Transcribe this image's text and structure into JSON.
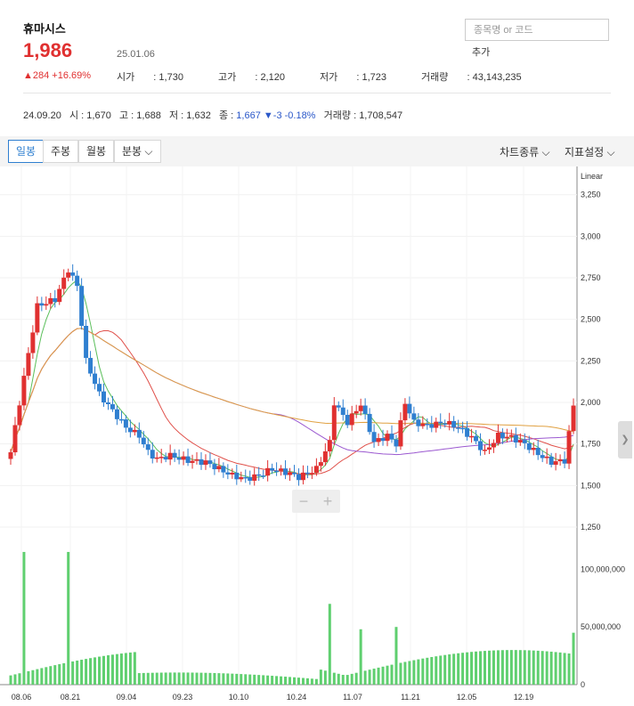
{
  "header": {
    "stock_name": "휴마시스",
    "price": "1,986",
    "date": "25.01.06",
    "change": "▲284 +16.69%",
    "metrics": [
      {
        "label": "시가",
        "value": "1,730"
      },
      {
        "label": "고가",
        "value": "2,120"
      },
      {
        "label": "저가",
        "value": "1,723"
      },
      {
        "label": "거래량",
        "value": "43,143,235"
      }
    ],
    "search_placeholder": "종목명 or 코드",
    "add_label": "추가"
  },
  "prev_day": {
    "date": "24.09.20",
    "open_label": "시",
    "open": "1,670",
    "high_label": "고",
    "high": "1,688",
    "low_label": "저",
    "low": "1,632",
    "close_label": "종",
    "close": "1,667",
    "change": "▼-3 -0.18%",
    "volume_label": "거래량",
    "volume": "1,708,547"
  },
  "toolbar": {
    "tabs": [
      "일봉",
      "주봉",
      "월봉",
      "분봉"
    ],
    "active_tab": "일봉",
    "chart_type": "차트종류",
    "indicator": "지표설정"
  },
  "colors": {
    "up": "#e03030",
    "down": "#2f7fd0",
    "ma5": "#5bbf5b",
    "ma20": "#e0504a",
    "ma60": "#9b59d0",
    "ma120": "#e0a040",
    "volume": "#5fcf6f"
  },
  "chart_data": {
    "type": "candlestick",
    "scale_label": "Linear",
    "y_ticks": [
      1250,
      1500,
      1750,
      2000,
      2250,
      2500,
      2750,
      3000,
      3250
    ],
    "ylim": [
      1250,
      3420
    ],
    "x_labels": [
      "08.06",
      "08.21",
      "09.04",
      "09.23",
      "10.10",
      "10.24",
      "11.07",
      "11.21",
      "12.05",
      "12.19"
    ],
    "volume_ticks": [
      "0",
      "50,000,000",
      "100,000,000"
    ],
    "volume_max": 125000000
  },
  "zoom": {
    "minus": "−",
    "plus": "+"
  },
  "side_handle": "❯"
}
